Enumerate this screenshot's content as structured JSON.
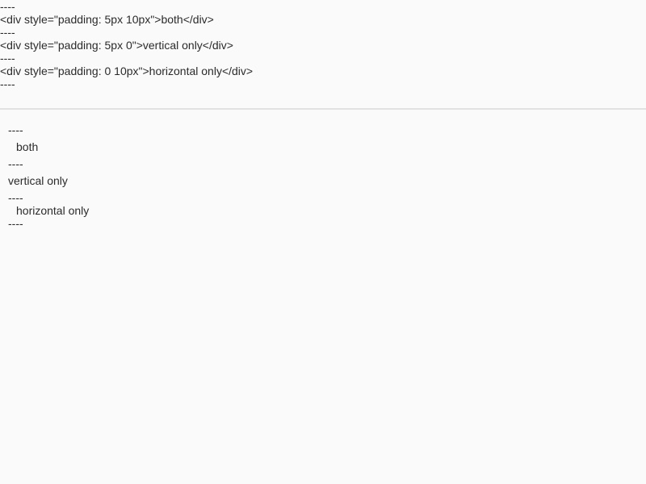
{
  "source": {
    "lines": [
      "----",
      "<div style=\"padding: 5px 10px\">both</div>",
      "----",
      "<div style=\"padding: 5px 0\">vertical only</div>",
      "----",
      "<div style=\"padding: 0 10px\">horizontal only</div>",
      "----"
    ]
  },
  "preview": {
    "separator": "----",
    "both": "both",
    "vertical_only": "vertical only",
    "horizontal_only": "horizontal only"
  }
}
